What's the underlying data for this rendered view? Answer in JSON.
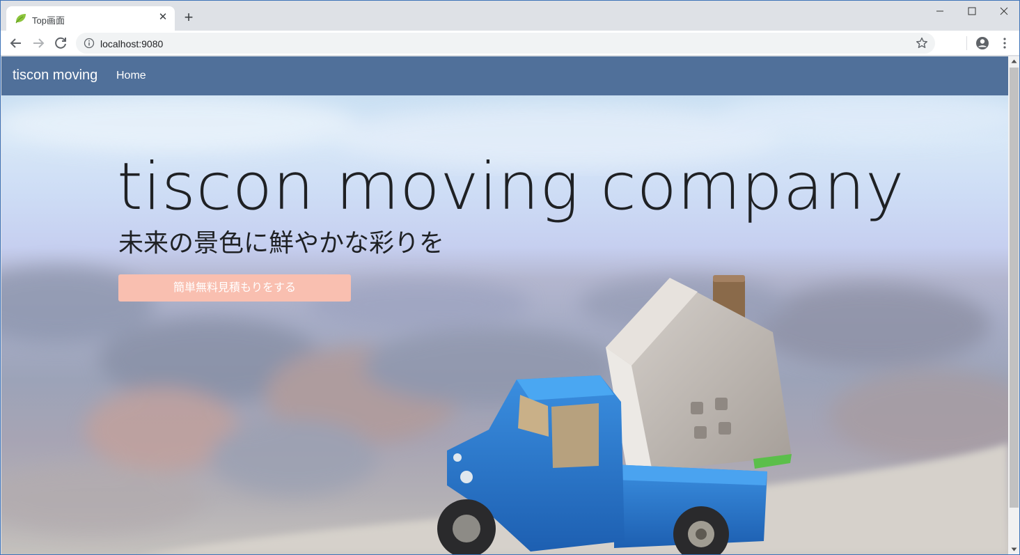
{
  "browser": {
    "tab_title": "Top画面",
    "tab_close": "✕",
    "new_tab": "+",
    "url": "localhost:9080",
    "icons": [
      "leaf-favicon-icon",
      "back-arrow-icon",
      "forward-arrow-icon",
      "reload-icon",
      "info-icon",
      "star-icon",
      "profile-icon",
      "menu-icon",
      "minimize-icon",
      "maximize-icon",
      "close-icon"
    ]
  },
  "navbar": {
    "brand": "tiscon moving",
    "home": "Home",
    "color": "#50709a"
  },
  "hero": {
    "title": "tiscon moving company",
    "subtitle": "未来の景色に鮮やかな彩りを",
    "cta_label": "簡単無料見積もりをする",
    "cta_color": "#f9bfb0",
    "image": "toy blue truck carrying a model house on a blurred city background"
  }
}
